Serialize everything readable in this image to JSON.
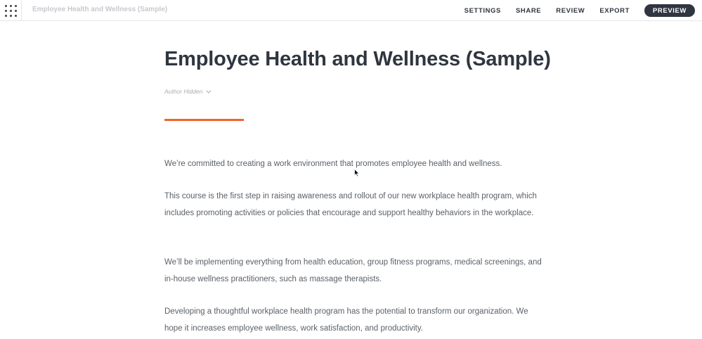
{
  "header": {
    "course_title": "Employee Health and Wellness (Sample)",
    "nav": {
      "settings": "SETTINGS",
      "share": "SHARE",
      "review": "REVIEW",
      "export": "EXPORT",
      "preview": "PREVIEW"
    }
  },
  "main": {
    "title": "Employee Health and Wellness (Sample)",
    "author": "Author Hidden",
    "paragraphs": [
      "We’re committed to creating a work environment that promotes employee health and wellness.",
      "This course is the first step in raising awareness and rollout of our new workplace health program, which includes promoting activities or policies that encourage and support healthy behaviors in the workplace.",
      "We’ll be implementing everything from health education, group fitness programs, medical screenings, and in-house wellness practitioners, such as massage therapists.",
      "Developing a thoughtful workplace health program has the potential to transform our organization. We hope it increases employee wellness, work satisfaction, and productivity."
    ]
  },
  "colors": {
    "accent": "#f0662a",
    "dark": "#2f3640",
    "body_text": "#5b6168"
  }
}
